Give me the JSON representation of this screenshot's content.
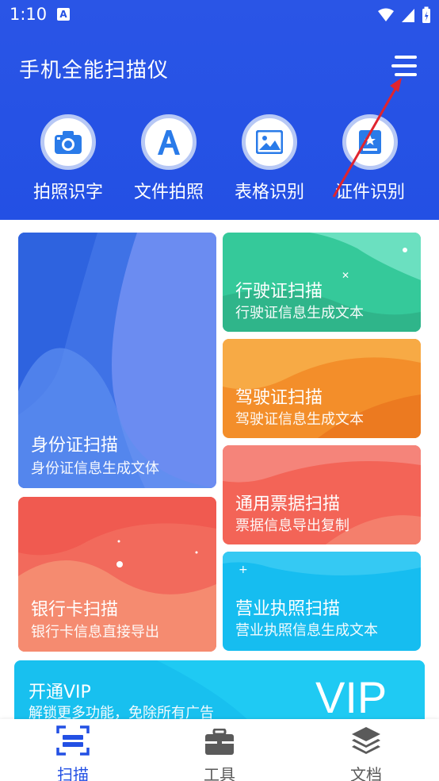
{
  "status": {
    "time": "1:10"
  },
  "header": {
    "title": "手机全能扫描仪"
  },
  "quick_actions": [
    {
      "label": "拍照识字",
      "icon": "camera-icon"
    },
    {
      "label": "文件拍照",
      "icon": "letter-a-icon"
    },
    {
      "label": "表格识别",
      "icon": "image-icon"
    },
    {
      "label": "证件识别",
      "icon": "id-card-icon"
    }
  ],
  "cards": {
    "id_card": {
      "title": "身份证扫描",
      "sub": "身份证信息生成文体"
    },
    "vehicle_license": {
      "title": "行驶证扫描",
      "sub": "行驶证信息生成文本"
    },
    "driver_license": {
      "title": "驾驶证扫描",
      "sub": "驾驶证信息生成文本"
    },
    "bank_card": {
      "title": "银行卡扫描",
      "sub": "银行卡信息直接导出"
    },
    "receipt": {
      "title": "通用票据扫描",
      "sub": "票据信息导出复制"
    },
    "business_license": {
      "title": "营业执照扫描",
      "sub": "营业执照信息生成文本"
    }
  },
  "vip": {
    "title": "开通VIP",
    "sub": "解锁更多功能，免除所有广告",
    "badge": "VIP"
  },
  "bottom_nav": [
    {
      "label": "扫描",
      "icon": "scan-icon",
      "active": true
    },
    {
      "label": "工具",
      "icon": "toolbox-icon",
      "active": false
    },
    {
      "label": "文档",
      "icon": "layers-icon",
      "active": false
    }
  ],
  "colors": {
    "primary": "#2350e4",
    "arrow": "#e0242e"
  }
}
